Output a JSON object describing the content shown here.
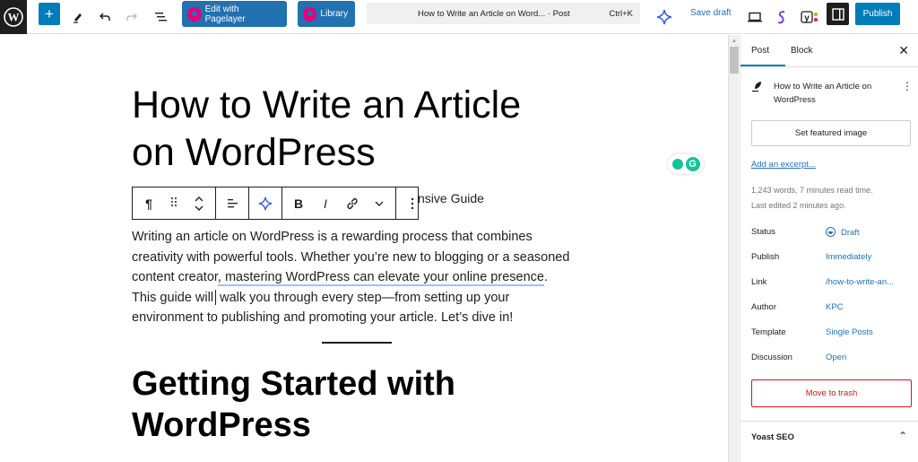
{
  "topbar": {
    "add_label": "+",
    "pagelayer_edit_label": "Edit with Pagelayer",
    "pagelayer_library_label": "Library",
    "command_bar_title": "How to Write an Article on Word...  · Post",
    "command_bar_shortcut": "Ctrl+K",
    "save_draft_label": "Save draft",
    "publish_label": "Publish"
  },
  "editor": {
    "post_title": "How to Write an Article on WordPress",
    "subtitle_fragment": "nsive Guide",
    "paragraph_before": "Writing an article on WordPress is a rewarding process that combines creativity with powerful tools. Whether you’re new to blogging or a seasoned content creator",
    "paragraph_underlined": ", mastering WordPress can elevate your online presence",
    "paragraph_after_1": ". This guide will",
    "paragraph_after_2": " walk you through every step—from setting up your environment to publishing and promoting your article. Let’s dive in!",
    "heading2": "Getting Started with WordPress"
  },
  "block_toolbar": {
    "paragraph_icon": "¶",
    "drag_icon": "⠿",
    "bold": "B",
    "italic": "I"
  },
  "sidebar": {
    "tabs": [
      "Post",
      "Block"
    ],
    "close": "✕",
    "post_title": "How to Write an Article on WordPress",
    "featured_image_label": "Set featured image",
    "excerpt_link": "Add an excerpt...",
    "word_count": "1,243 words, 7 minutes read time.",
    "last_edited": "Last edited 2 minutes ago.",
    "rows": [
      {
        "label": "Status",
        "value": "Draft"
      },
      {
        "label": "Publish",
        "value": "Immediately"
      },
      {
        "label": "Link",
        "value": "/how-to-write-an..."
      },
      {
        "label": "Author",
        "value": "KPC"
      },
      {
        "label": "Template",
        "value": "Single Posts"
      },
      {
        "label": "Discussion",
        "value": "Open"
      }
    ],
    "trash_label": "Move to trash",
    "yoast_label": "Yoast SEO"
  },
  "colors": {
    "accent": "#007cba",
    "pagelayer": "#2271b1",
    "pagelayer_logo": "#e6007e",
    "danger": "#cc1818"
  }
}
